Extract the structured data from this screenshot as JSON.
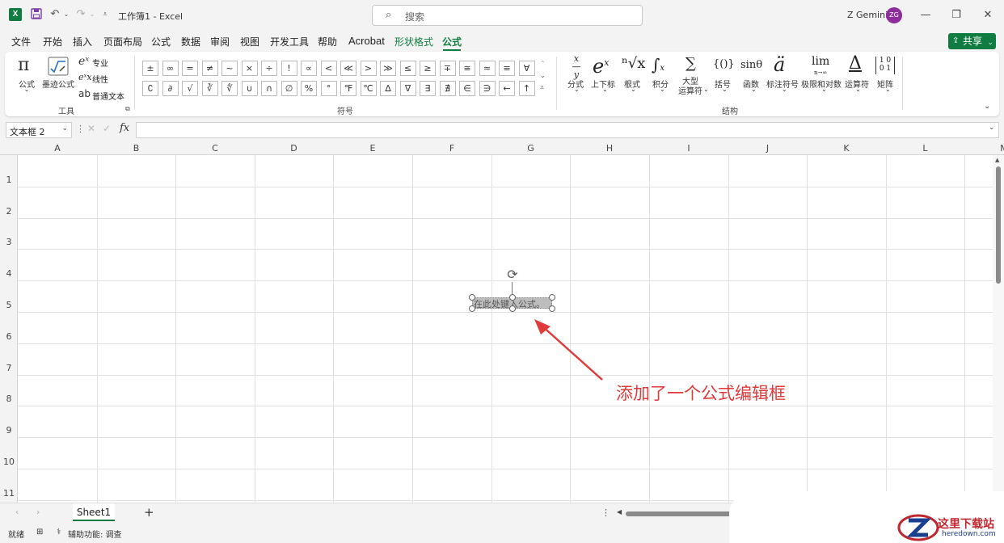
{
  "titlebar": {
    "app_icon": "X",
    "title": "工作簿1  -  Excel",
    "search_placeholder": "搜索",
    "user_name": "Z Gemini",
    "avatar_initials": "ZG",
    "minimize": "—",
    "restore": "❐",
    "close": "✕"
  },
  "menu": {
    "items": [
      "文件",
      "开始",
      "插入",
      "页面布局",
      "公式",
      "数据",
      "审阅",
      "视图",
      "开发工具",
      "帮助",
      "Acrobat",
      "形状格式",
      "公式"
    ],
    "share": "共享",
    "active_color": "#107c41"
  },
  "ribbon": {
    "tools": {
      "equation": "公式",
      "ink": "墨迹公式",
      "pro": "专业",
      "linear": "线性",
      "normal_text": "普通文本",
      "group": "工具"
    },
    "symbols": {
      "row1": [
        "±",
        "∞",
        "=",
        "≠",
        "~",
        "×",
        "÷",
        "!",
        "∝",
        "<",
        "≪",
        ">",
        "≫",
        "≤",
        "≥",
        "∓",
        "≅",
        "≈",
        "≡",
        "∀"
      ],
      "row2": [
        "∁",
        "∂",
        "√",
        "∛",
        "∜",
        "∪",
        "∩",
        "∅",
        "%",
        "°",
        "℉",
        "℃",
        "∆",
        "∇",
        "∃",
        "∄",
        "∈",
        "∋",
        "←",
        "↑"
      ],
      "group": "符号"
    },
    "structures": {
      "items": [
        {
          "label": "分式",
          "glyph": "x/y"
        },
        {
          "label": "上下标",
          "glyph": "eˣ"
        },
        {
          "label": "根式",
          "glyph": "ⁿ√x"
        },
        {
          "label": "积分",
          "glyph": "∫"
        },
        {
          "label": "大型\n运算符",
          "glyph": "∑"
        },
        {
          "label": "括号",
          "glyph": "{()}"
        },
        {
          "label": "函数",
          "glyph": "sinθ"
        },
        {
          "label": "标注符号",
          "glyph": "ä"
        },
        {
          "label": "极限和对数",
          "glyph": "lim"
        },
        {
          "label": "运算符",
          "glyph": "Δ"
        },
        {
          "label": "矩阵",
          "glyph": "[10 01]"
        }
      ],
      "group": "结构"
    }
  },
  "formula_bar": {
    "name_box": "文本框 2",
    "fx": "fx",
    "value": ""
  },
  "grid": {
    "columns": [
      "A",
      "B",
      "C",
      "D",
      "E",
      "F",
      "G",
      "H",
      "I",
      "J",
      "K",
      "L",
      "M"
    ],
    "rows": [
      "1",
      "2",
      "3",
      "4",
      "5",
      "6",
      "7",
      "8",
      "9",
      "10",
      "11"
    ]
  },
  "equation_box": {
    "placeholder": "在此处键入公式。"
  },
  "annotation": {
    "text": "添加了一个公式编辑框",
    "color": "#e03a3a"
  },
  "sheets": {
    "tabs": [
      "Sheet1"
    ],
    "add": "+"
  },
  "status": {
    "ready": "就绪",
    "accessibility": "辅助功能: 调查"
  },
  "watermark": {
    "text": "这里下载站",
    "url": "heredown.com"
  }
}
